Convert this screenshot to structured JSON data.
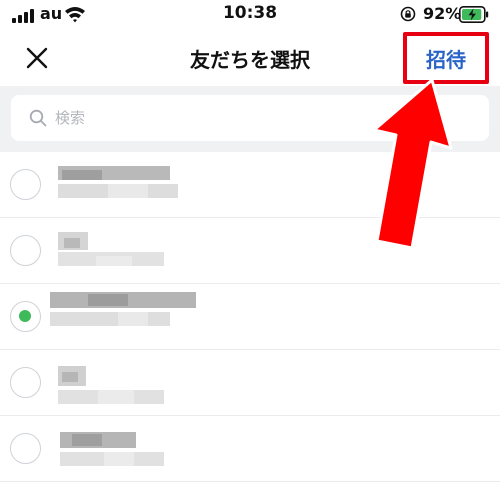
{
  "status_bar": {
    "carrier": "au",
    "time": "10:38",
    "battery_percent": "92%",
    "battery_level": 0.92
  },
  "header": {
    "title": "友だちを選択",
    "invite_label": "招待"
  },
  "search": {
    "placeholder": "検索"
  },
  "friends": [
    {
      "selected": false
    },
    {
      "selected": false
    },
    {
      "selected": true
    },
    {
      "selected": false
    },
    {
      "selected": false
    }
  ],
  "colors": {
    "invite_text": "#2a64c8",
    "highlight_box": "#e60012",
    "annotation_arrow": "#ff0000",
    "selected_dot": "#3fba5a"
  }
}
